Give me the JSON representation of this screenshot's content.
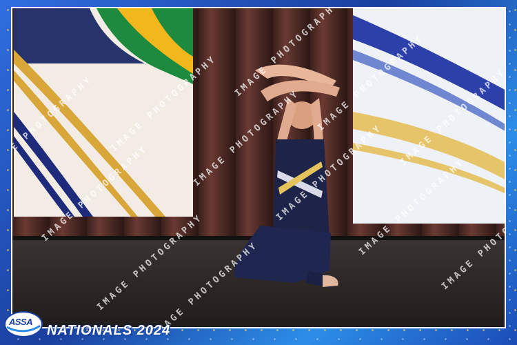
{
  "photo": {
    "subject": "Dancer kneeling on stage with crossed arms raised overhead",
    "colors": {
      "frame": "#1a4fb8",
      "costume": "#1d2447",
      "curtain": "#5a302b",
      "stage": "#2b2523"
    }
  },
  "watermark": {
    "text": "IMAGE PHOTOGRAPHY"
  },
  "logo": {
    "text": "ASSA"
  },
  "event": {
    "title": "NATIONALS 2024"
  }
}
